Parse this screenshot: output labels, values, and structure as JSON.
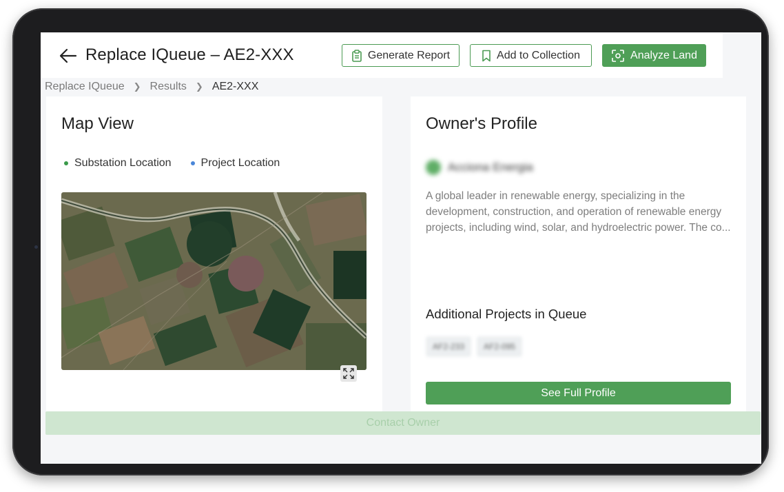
{
  "header": {
    "title": "Replace IQueue – AE2-XXX",
    "generate_report": "Generate Report",
    "add_to_collection": "Add to Collection",
    "analyze_land": "Analyze Land"
  },
  "breadcrumb": {
    "items": [
      "Replace IQueue",
      "Results",
      "AE2-XXX"
    ]
  },
  "map": {
    "title": "Map View",
    "legend": [
      {
        "label": "Substation Location",
        "color": "#3a9a4a"
      },
      {
        "label": "Project Location",
        "color": "#4a86d8"
      }
    ]
  },
  "owner": {
    "title": "Owner's Profile",
    "name": "Acciona Energia",
    "description": "A global leader in renewable energy, specializing in the development, construction, and operation of renewable energy projects, including wind, solar, and hydroelectric power. The co...",
    "additional_title": "Additional Projects in Queue",
    "projects": [
      "AF2-233",
      "AF2-095"
    ],
    "full_profile": "See Full Profile"
  },
  "contact": {
    "label": "Contact Owner"
  },
  "colors": {
    "brand_green": "#4f9f57",
    "contact_bg": "#cfe6d0"
  }
}
